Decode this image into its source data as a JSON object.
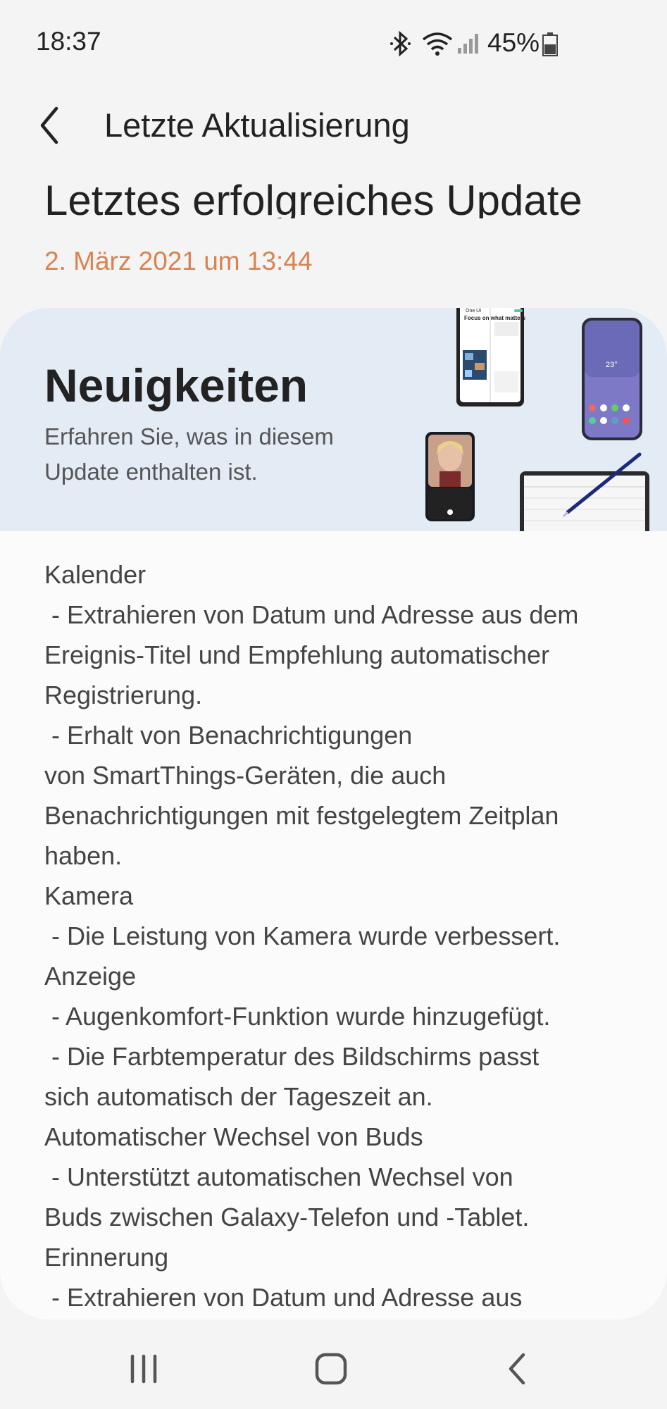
{
  "status_bar": {
    "time": "18:37",
    "battery_percent": "45%",
    "icons": [
      "bluetooth-icon",
      "wifi-icon",
      "signal-icon",
      "battery-icon"
    ]
  },
  "app_bar": {
    "title": "Letzte Aktualisierung",
    "back_icon": "back-arrow-icon"
  },
  "content": {
    "section_heading": "Letztes erfolgreiches Update",
    "update_date": "2. März 2021 um 13:44",
    "accent_color": "#d9834f"
  },
  "banner": {
    "title": "Neuigkeiten",
    "subtitle": "Erfahren Sie, was in diesem Update enthalten ist.",
    "illustration_texts": [
      "One UI",
      "Focus on what matters",
      "23°"
    ]
  },
  "changelog": {
    "lines": [
      "Kalender",
      " - Extrahieren von Datum und Adresse aus dem",
      "Ereignis-Titel und Empfehlung automatischer",
      "Registrierung.",
      " - Erhalt von Benachrichtigungen",
      "von SmartThings-Geräten, die auch",
      "Benachrichtigungen mit festgelegtem Zeitplan",
      "haben.",
      "Kamera",
      " - Die Leistung von Kamera wurde verbessert.",
      "Anzeige",
      " - Augenkomfort-Funktion wurde hinzugefügt.",
      " - Die Farbtemperatur des Bildschirms passt",
      "sich automatisch der Tageszeit an.",
      "Automatischer Wechsel von Buds",
      " - Unterstützt automatischen Wechsel von",
      "Buds zwischen Galaxy-Telefon und -Tablet.",
      "Erinnerung",
      " - Extrahieren von Datum und Adresse aus"
    ]
  },
  "nav_bar": {
    "buttons": [
      "recent-apps-icon",
      "home-icon",
      "back-icon"
    ]
  }
}
